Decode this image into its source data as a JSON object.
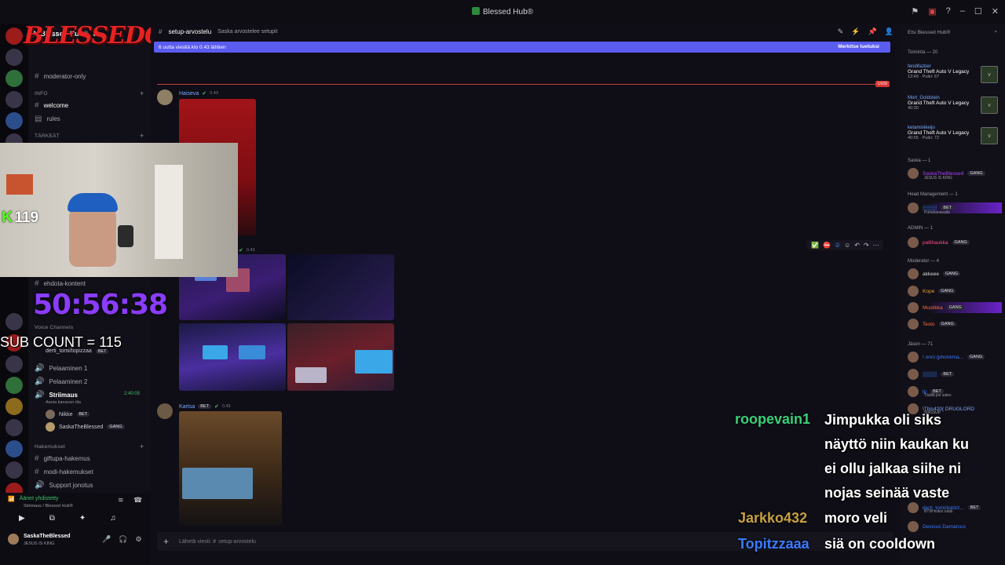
{
  "window": {
    "title": "Blessed Hub®"
  },
  "titlebar_icons": [
    "flag-icon",
    "screen-icon",
    "help-icon",
    "minimize-icon",
    "maximize-icon",
    "close-icon"
  ],
  "server": {
    "name": "Blessed Hub®",
    "logo_text": "BLESSEDGANG"
  },
  "channels": {
    "moderator_only": "moderator-only",
    "info_category": "INFO",
    "welcome": "welcome",
    "rules": "rules",
    "tarkeat_category": "TÄRKEÄT",
    "ehdota": "ehdota-kontent",
    "voice_category": "Voice Channels",
    "pelaaminen1": "Pelaaminen 1",
    "pelaaminen2": "Pelaaminen 2",
    "striimaus": "Striimaus",
    "striimaus_time": "2:40:05",
    "striimaus_status": "Aseta kanavan tila",
    "voice_user1": "Nikke",
    "voice_user2": "SaskaTheBlessed",
    "voice_user0": "derti_tomi/topizzaa",
    "hakemukset_category": "Hakemukset",
    "giftupa": "giftupa-hakemus",
    "modi": "modi-hakemukset",
    "support": "Support jonotus"
  },
  "voice_status": {
    "title": "Äänet yhdistetty",
    "sub": "Striimaus / Blessed Hub®"
  },
  "user_panel": {
    "name": "SaskaTheBlessed",
    "status": "JESUS IS KING"
  },
  "stream_overlay": {
    "kick_count": "119",
    "timer": "50:56:38",
    "sub_count": "SUB COUNT = 115"
  },
  "chat": {
    "channel": "setup-arvostelu",
    "topic": "Saska arvostelee setupit",
    "new_messages": "6 uutta viestiä klo 0.43 lähtien",
    "mark_read": "Merkitse luetuksi",
    "new_tag": "UUSI",
    "messages": [
      {
        "author": "Haiseva",
        "time": "0.43"
      },
      {
        "author": "",
        "time": "0.43"
      },
      {
        "author": "Kartsa",
        "badge": "BET",
        "time": "0.43"
      }
    ],
    "composer_placeholder": "Lähetä viesti: #",
    "composer_channel": "setup-arvostelu"
  },
  "members": {
    "search_placeholder": "Etsi Blessed Hub®",
    "activity_header": "Toiminta — 20",
    "activities": [
      {
        "name": "fendifazber",
        "game": "Grand Theft Auto V Legacy",
        "meta": "13:49 · Putki: 67"
      },
      {
        "name": "Mort_Goldstein",
        "game": "Grand Theft Auto V Legacy",
        "meta": "40:30"
      },
      {
        "name": "ketaminikeijo",
        "game": "Grand Theft Auto V Legacy",
        "meta": "40:55 · Putki: 72"
      }
    ],
    "groups": [
      {
        "label": "Saska — 1"
      },
      {
        "label": "Head Management — 1"
      },
      {
        "label": "ADMIN — 1"
      },
      {
        "label": "Moderator — 4"
      },
      {
        "label": "Jäsen — 71"
      }
    ],
    "saska": {
      "name": "SaskaTheBlessed",
      "badge": "GANG",
      "status": "JESUS IS KING"
    },
    "head": {
      "badge": "BET",
      "status": "Puhekanavalla"
    },
    "admin": {
      "name": "pallihaukka",
      "badge": "GANG"
    },
    "moderators": [
      {
        "name": "akkeee",
        "badge": "GANG",
        "color": "#d9d9d9"
      },
      {
        "name": "Kope",
        "badge": "GANG",
        "color": "#e8a23a"
      },
      {
        "name": "Mustikka",
        "badge": "GANG",
        "color": "#ff6b3a"
      },
      {
        "name": "Testo",
        "badge": "GANG",
        "color": "#ff6b3a"
      }
    ],
    "jasen": [
      {
        "name": "! onni (phonkma...",
        "badge": "GANG"
      },
      {
        "name": "",
        "badge": "BET"
      },
      {
        "name": "lp",
        "badge": "BET",
        "status": "Täällä jos sales"
      },
      {
        "name": "\\Tbis420( DRUGLORD",
        "status": "W4SSUP"
      },
      {
        "name": "derti_tomi/topizz...",
        "badge": "BET",
        "status": "BTW kokoi nääs"
      },
      {
        "name": "Devious Damarcus"
      }
    ]
  },
  "overlay_chat": [
    {
      "user": "roopevain1",
      "color": "#3ad07a",
      "lines": [
        "Jimpukka oli siks",
        "näyttö niin kaukan ku",
        "ei ollu jalkaa siihe ni",
        "nojas seinää vaste"
      ]
    },
    {
      "user": "Jarkko432",
      "color": "#c6a040",
      "lines": [
        "moro veli"
      ]
    },
    {
      "user": "Topitzzaaa",
      "color": "#3b7bff",
      "lines": [
        "siä on cooldown"
      ]
    }
  ],
  "colors": {
    "accent": "#5b5cf0",
    "unread_red": "#d73535",
    "bg": "#0f0e16",
    "timer_purple": "#8a3cff",
    "kick_green": "#53fc18"
  }
}
